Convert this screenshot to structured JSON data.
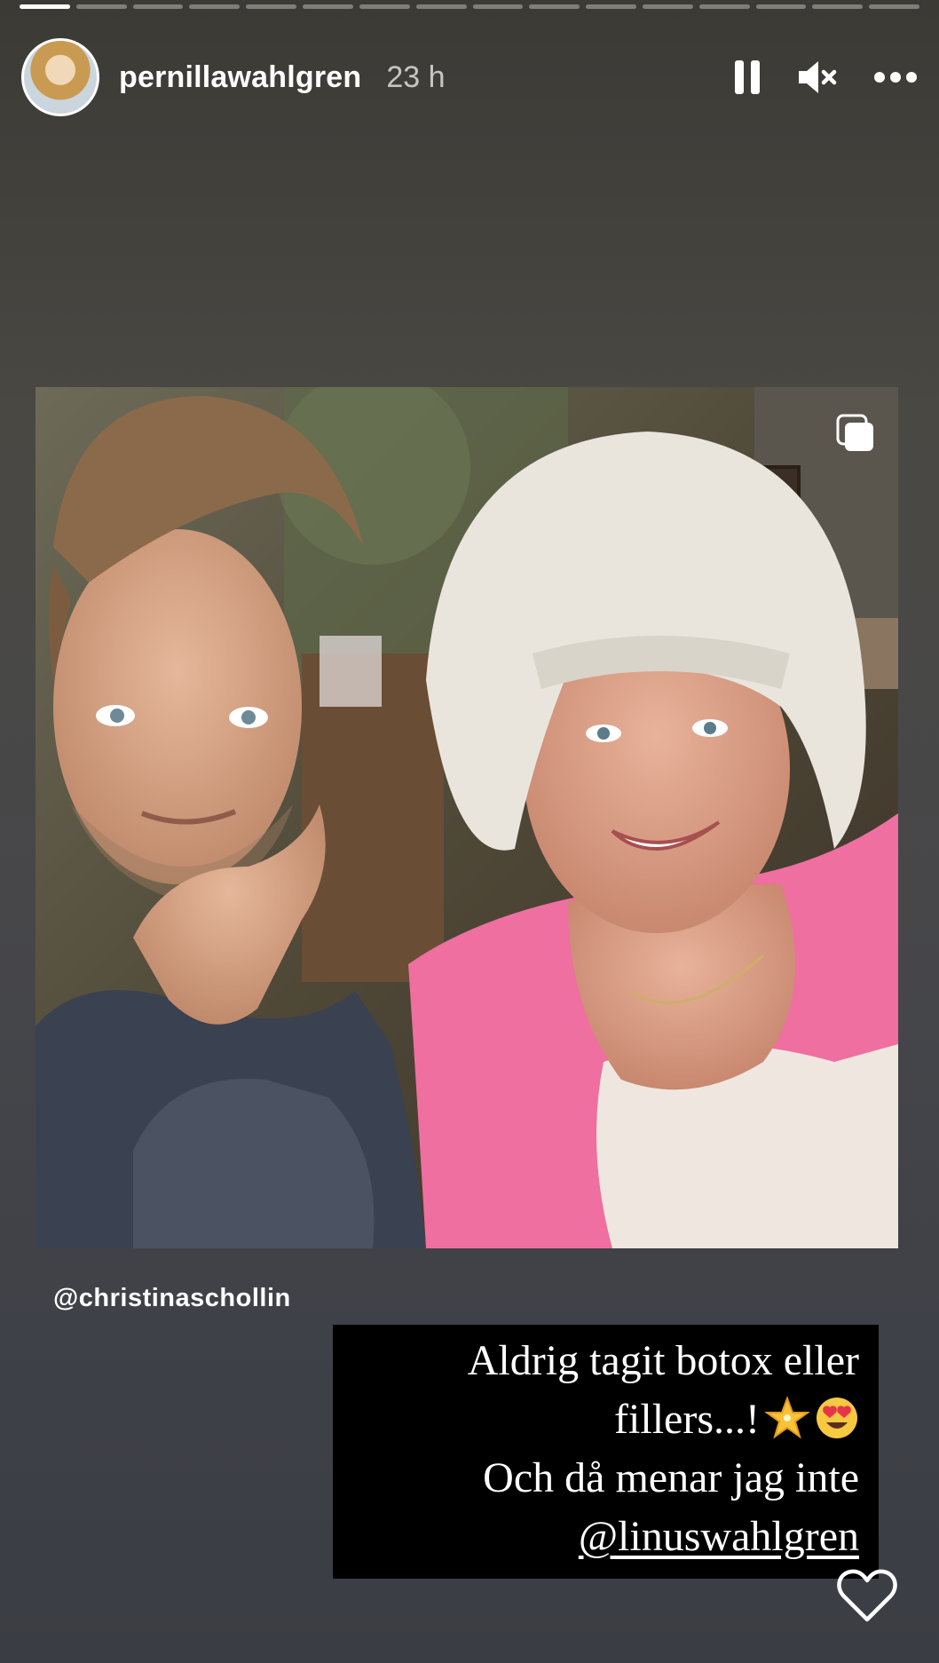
{
  "progress": {
    "segments": 16,
    "active_index": 0,
    "colors": {
      "active": "#ffffff",
      "inactive": "rgba(255,255,255,0.35)"
    }
  },
  "header": {
    "username": "pernillawahlgren",
    "time": "23 h",
    "icons": {
      "pause": "pause-icon",
      "mute": "speaker-muted-icon",
      "more": "more-options-icon"
    }
  },
  "post": {
    "image_description": "selfie photo",
    "icon": "multiple-posts-icon"
  },
  "mention": "@christinaschollin",
  "caption": {
    "line1": "Aldrig tagit botox eller",
    "line2": "fillers...!",
    "line3": "Och då menar jag inte",
    "line4": "@linuswahlgren",
    "emojis": [
      "star-emoji",
      "heart-eyes-emoji"
    ]
  },
  "footer": {
    "icon": "heart-icon"
  }
}
